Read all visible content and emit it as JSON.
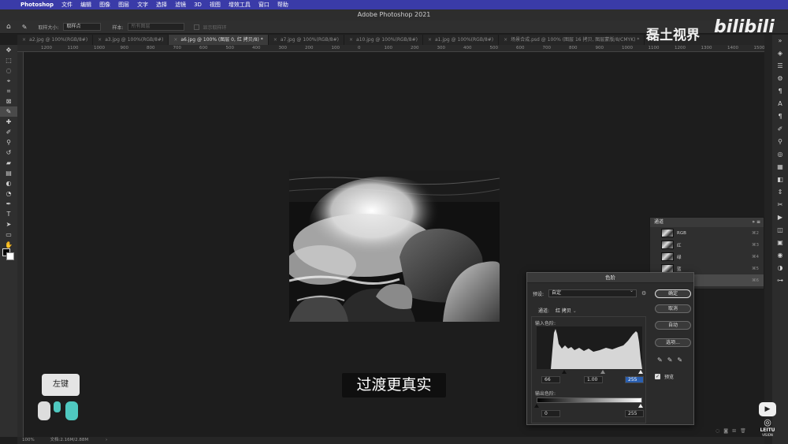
{
  "menubar": {
    "app_name": "Photoshop",
    "items": [
      "文件",
      "编辑",
      "图像",
      "图层",
      "文字",
      "选择",
      "滤镜",
      "3D",
      "视图",
      "增效工具",
      "窗口",
      "帮助"
    ]
  },
  "window": {
    "title": "Adobe Photoshop 2021"
  },
  "options_bar": {
    "sample_size_label": "取样大小:",
    "sample_size_value": "取样点",
    "sample_label": "样本:",
    "sample_value": "所有图层",
    "show_ring_label": "显示取样环"
  },
  "tabs": [
    {
      "label": "a2.jpg @ 100%(RGB/8#)",
      "active": false
    },
    {
      "label": "a3.jpg @ 100%(RGB/8#)",
      "active": false
    },
    {
      "label": "a6.jpg @ 100% (图层 0, 红 拷贝/8) *",
      "active": true
    },
    {
      "label": "a7.jpg @ 100%(RGB/8#)",
      "active": false
    },
    {
      "label": "a10.jpg @ 100%(RGB/8#)",
      "active": false
    },
    {
      "label": "a1.jpg @ 100%(RGB/8#)",
      "active": false
    },
    {
      "label": "场景合成.psd @ 100% (图层 16 拷贝, 图层蒙版/8/CMYK) *",
      "active": false
    }
  ],
  "ruler_ticks": [
    "1200",
    "1100",
    "1000",
    "900",
    "800",
    "700",
    "600",
    "500",
    "400",
    "300",
    "200",
    "100",
    "0",
    "100",
    "200",
    "300",
    "400",
    "500",
    "600",
    "700",
    "800",
    "900",
    "1000",
    "1100",
    "1200",
    "1300",
    "1400",
    "1500"
  ],
  "status": {
    "zoom": "100%",
    "doc": "文档:2.16M/2.88M"
  },
  "channels_panel": {
    "title": "通道",
    "rows": [
      {
        "name": "RGB",
        "key": "⌘2"
      },
      {
        "name": "红",
        "key": "⌘3"
      },
      {
        "name": "绿",
        "key": "⌘4"
      },
      {
        "name": "蓝",
        "key": "⌘5"
      },
      {
        "name": "",
        "key": "⌘6"
      }
    ]
  },
  "levels_dialog": {
    "title": "色阶",
    "preset_label": "预设:",
    "preset_value": "自定",
    "channel_label": "通道:",
    "channel_value": "红 拷贝",
    "input_label": "输入色阶:",
    "input_black": "66",
    "input_gamma": "1.00",
    "input_white": "255",
    "output_label": "输出色阶:",
    "output_black": "0",
    "output_white": "255",
    "ok_label": "确定",
    "cancel_label": "取消",
    "auto_label": "自动",
    "options_label": "选项...",
    "preview_label": "预览",
    "preview_checked": true
  },
  "subtitle": "过渡更真实",
  "mouse_hint": "左键",
  "watermark": {
    "channel_name": "磊土视界",
    "bilibili": "bilibili",
    "brand": "LEITU",
    "brand_sub": "VISION"
  }
}
